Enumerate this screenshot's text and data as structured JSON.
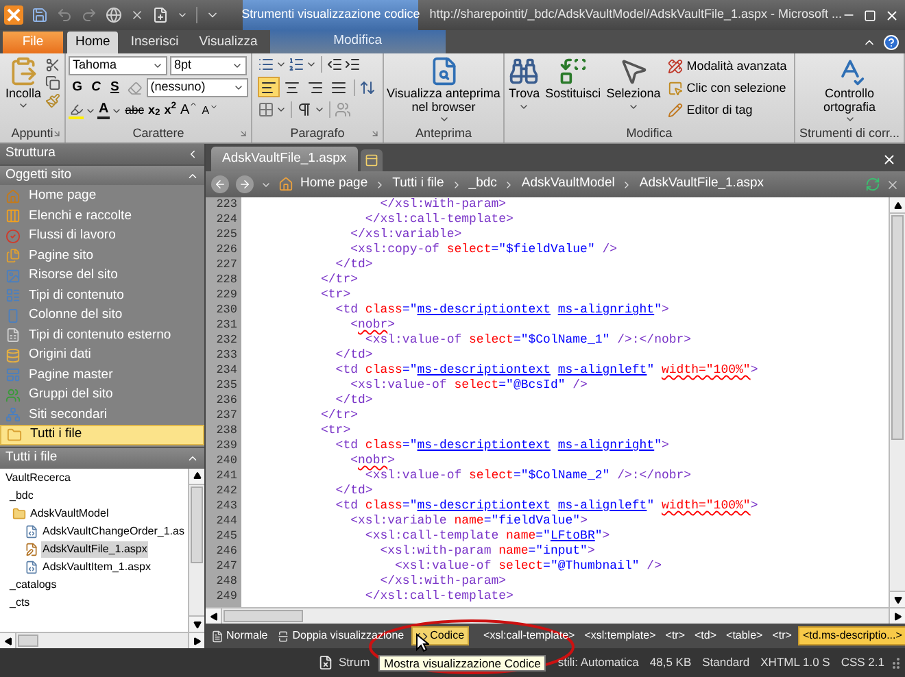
{
  "title_bar": {
    "contextual_header": "Strumenti visualizzazione codice",
    "title": "http://sharepointit/_bdc/AdskVaultModel/AdskVaultFile_1.aspx - Microsoft ..."
  },
  "ribbon_tabs": [
    {
      "label": "File",
      "kind": "file",
      "selected": false
    },
    {
      "label": "Home",
      "kind": "normal",
      "selected": true
    },
    {
      "label": "Inserisci",
      "kind": "normal",
      "selected": false
    },
    {
      "label": "Visualizza",
      "kind": "normal",
      "selected": false
    },
    {
      "label": "Modifica",
      "kind": "contextual",
      "selected": false
    }
  ],
  "ribbon": {
    "appunti": {
      "paste": "Incolla",
      "label": "Appunti"
    },
    "carattere": {
      "font": "Tahoma",
      "size": "8pt",
      "style": "(nessuno)",
      "format_buttons": [
        {
          "text": "G",
          "kind": "bold"
        },
        {
          "text": "C",
          "kind": "italic"
        },
        {
          "text": "S",
          "kind": "underline"
        }
      ],
      "font_color": "A",
      "strikethrough": "abc",
      "subscript": "x$_{2}$",
      "superscript": "x$^{2}$",
      "grow": "A",
      "shrink": "A",
      "label": "Carattere"
    },
    "paragrafo": {
      "alignment": [
        {
          "kind": "left",
          "selected": true
        },
        {
          "kind": "center",
          "selected": false
        },
        {
          "kind": "right",
          "selected": false
        },
        {
          "kind": "justify",
          "selected": false
        }
      ],
      "label": "Paragrafo"
    },
    "anteprima": {
      "button": "Visualizza anteprima nel browser",
      "label": "Anteprima"
    },
    "modifica": {
      "large_buttons": [
        {
          "label": "Trova",
          "kind": "find"
        },
        {
          "label": "Sostituisci",
          "kind": "replace"
        },
        {
          "label": "Seleziona",
          "kind": "select"
        }
      ],
      "small_buttons": [
        {
          "label": "Modalità avanzata",
          "kind": "advanced"
        },
        {
          "label": "Clic con selezione",
          "kind": "click"
        },
        {
          "label": "Editor di tag",
          "kind": "tag"
        }
      ],
      "label": "Modifica"
    },
    "strumenti": {
      "button": "Controllo ortografia",
      "label": "Strumenti di corr..."
    }
  },
  "sidebar": {
    "title": "Struttura",
    "section": "Oggetti sito",
    "items": [
      {
        "label": "Home page",
        "kind": "home",
        "selected": false
      },
      {
        "label": "Elenchi e raccolte",
        "kind": "lists",
        "selected": false
      },
      {
        "label": "Flussi di lavoro",
        "kind": "workflow",
        "selected": false
      },
      {
        "label": "Pagine sito",
        "kind": "pages",
        "selected": false
      },
      {
        "label": "Risorse del sito",
        "kind": "assets",
        "selected": false
      },
      {
        "label": "Tipi di contenuto",
        "kind": "content",
        "selected": false
      },
      {
        "label": "Colonne del sito",
        "kind": "columns",
        "selected": false
      },
      {
        "label": "Tipi di contenuto esterno",
        "kind": "external",
        "selected": false
      },
      {
        "label": "Origini dati",
        "kind": "data",
        "selected": false
      },
      {
        "label": "Pagine master",
        "kind": "master",
        "selected": false
      },
      {
        "label": "Gruppi del sito",
        "kind": "groups",
        "selected": false
      },
      {
        "label": "Siti secondari",
        "kind": "subsites",
        "selected": false
      },
      {
        "label": "Tutti i file",
        "kind": "files",
        "selected": true
      }
    ],
    "tree_title": "Tutti i file",
    "tree": [
      {
        "label": "VaultRecerca",
        "selected": false,
        "children": [
          {
            "label": "_bdc",
            "selected": false,
            "children": [
              {
                "label": "AdskVaultModel",
                "kind": "folder",
                "selected": false,
                "children": [
                  {
                    "label": "AdskVaultChangeOrder_1.as",
                    "kind": "file",
                    "selected": false
                  },
                  {
                    "label": "AdskVaultFile_1.aspx",
                    "kind": "file-edit",
                    "selected": true
                  },
                  {
                    "label": "AdskVaultItem_1.aspx",
                    "kind": "file",
                    "selected": false
                  }
                ]
              }
            ]
          },
          {
            "label": "_catalogs",
            "selected": false
          },
          {
            "label": "_cts",
            "selected": false
          }
        ]
      }
    ]
  },
  "editor": {
    "tabs": [
      {
        "label": "AdskVaultFile_1.aspx",
        "selected": true
      }
    ],
    "breadcrumb": [
      "Home page",
      "Tutti i file",
      "_bdc",
      "AdskVaultModel",
      "AdskVaultFile_1.aspx"
    ],
    "lines": [
      {
        "number": "223",
        "tokens": [
          {
            "kind": "tag",
            "text": "                  </xsl:with-param>"
          }
        ]
      },
      {
        "number": "224",
        "tokens": [
          {
            "kind": "tag",
            "text": "                </xsl:call-template>"
          }
        ]
      },
      {
        "number": "225",
        "tokens": [
          {
            "kind": "tag",
            "text": "              </xsl:variable>"
          }
        ]
      },
      {
        "number": "226",
        "tokens": [
          {
            "kind": "tag",
            "text": "              <xsl:copy-of "
          },
          {
            "kind": "attr",
            "text": "select"
          },
          {
            "kind": "str",
            "text": "=\"$fieldValue\" "
          },
          {
            "kind": "tag",
            "text": "/>"
          }
        ]
      },
      {
        "number": "227",
        "tokens": [
          {
            "kind": "tag",
            "text": "            </td>"
          }
        ]
      },
      {
        "number": "228",
        "tokens": [
          {
            "kind": "tag",
            "text": "          </tr>"
          }
        ]
      },
      {
        "number": "229",
        "tokens": [
          {
            "kind": "tag",
            "text": "          <tr>"
          }
        ]
      },
      {
        "number": "230",
        "tokens": [
          {
            "kind": "tag",
            "text": "            <td "
          },
          {
            "kind": "attr",
            "text": "class"
          },
          {
            "kind": "str",
            "text": "=\""
          },
          {
            "kind": "links",
            "items": [
              "ms-descriptiontext",
              "ms-alignright"
            ]
          },
          {
            "kind": "str",
            "text": "\""
          },
          {
            "kind": "tag",
            "text": ">"
          }
        ]
      },
      {
        "number": "231",
        "tokens": [
          {
            "kind": "tag",
            "text": "              <"
          },
          {
            "kind": "tag-error",
            "text": "nobr"
          },
          {
            "kind": "tag",
            "text": ">"
          }
        ]
      },
      {
        "number": "232",
        "tokens": [
          {
            "kind": "tag",
            "text": "                <xsl:value-of "
          },
          {
            "kind": "attr",
            "text": "select"
          },
          {
            "kind": "str",
            "text": "=\"$ColName_1\" "
          },
          {
            "kind": "tag",
            "text": "/>:</nobr>"
          }
        ]
      },
      {
        "number": "233",
        "tokens": [
          {
            "kind": "tag",
            "text": "            </td>"
          }
        ]
      },
      {
        "number": "234",
        "tokens": [
          {
            "kind": "tag",
            "text": "            <td "
          },
          {
            "kind": "attr",
            "text": "class"
          },
          {
            "kind": "str",
            "text": "=\""
          },
          {
            "kind": "links",
            "items": [
              "ms-descriptiontext",
              "ms-alignleft"
            ]
          },
          {
            "kind": "str",
            "text": "\" "
          },
          {
            "kind": "attr-error",
            "text": "width=\"100%\""
          },
          {
            "kind": "tag",
            "text": ">"
          }
        ]
      },
      {
        "number": "235",
        "tokens": [
          {
            "kind": "tag",
            "text": "              <xsl:value-of "
          },
          {
            "kind": "attr",
            "text": "select"
          },
          {
            "kind": "str",
            "text": "=\"@BcsId\" "
          },
          {
            "kind": "tag",
            "text": "/>"
          }
        ]
      },
      {
        "number": "236",
        "tokens": [
          {
            "kind": "tag",
            "text": "            </td>"
          }
        ]
      },
      {
        "number": "237",
        "tokens": [
          {
            "kind": "tag",
            "text": "          </tr>"
          }
        ]
      },
      {
        "number": "238",
        "tokens": [
          {
            "kind": "tag",
            "text": "          <tr>"
          }
        ]
      },
      {
        "number": "239",
        "tokens": [
          {
            "kind": "tag",
            "text": "            <td "
          },
          {
            "kind": "attr",
            "text": "class"
          },
          {
            "kind": "str",
            "text": "=\""
          },
          {
            "kind": "links",
            "items": [
              "ms-descriptiontext",
              "ms-alignright"
            ]
          },
          {
            "kind": "str",
            "text": "\""
          },
          {
            "kind": "tag",
            "text": ">"
          }
        ]
      },
      {
        "number": "240",
        "tokens": [
          {
            "kind": "tag",
            "text": "              <"
          },
          {
            "kind": "tag-error",
            "text": "nobr"
          },
          {
            "kind": "tag",
            "text": ">"
          }
        ]
      },
      {
        "number": "241",
        "tokens": [
          {
            "kind": "tag",
            "text": "                <xsl:value-of "
          },
          {
            "kind": "attr",
            "text": "select"
          },
          {
            "kind": "str",
            "text": "=\"$ColName_2\" "
          },
          {
            "kind": "tag",
            "text": "/>:</nobr>"
          }
        ]
      },
      {
        "number": "242",
        "tokens": [
          {
            "kind": "tag",
            "text": "            </td>"
          }
        ]
      },
      {
        "number": "243",
        "tokens": [
          {
            "kind": "tag",
            "text": "            <td "
          },
          {
            "kind": "attr",
            "text": "class"
          },
          {
            "kind": "str",
            "text": "=\""
          },
          {
            "kind": "links",
            "items": [
              "ms-descriptiontext",
              "ms-alignleft"
            ]
          },
          {
            "kind": "str",
            "text": "\" "
          },
          {
            "kind": "attr-error",
            "text": "width=\"100%\""
          },
          {
            "kind": "tag",
            "text": ">"
          }
        ]
      },
      {
        "number": "244",
        "tokens": [
          {
            "kind": "tag",
            "text": "              <xsl:variable "
          },
          {
            "kind": "attr",
            "text": "name"
          },
          {
            "kind": "str",
            "text": "=\"fieldValue\""
          },
          {
            "kind": "tag",
            "text": ">"
          }
        ]
      },
      {
        "number": "245",
        "tokens": [
          {
            "kind": "tag",
            "text": "                <xsl:call-template "
          },
          {
            "kind": "attr",
            "text": "name"
          },
          {
            "kind": "str",
            "text": "=\""
          },
          {
            "kind": "link",
            "text": "LFtoBR"
          },
          {
            "kind": "str",
            "text": "\""
          },
          {
            "kind": "tag",
            "text": ">"
          }
        ]
      },
      {
        "number": "246",
        "tokens": [
          {
            "kind": "tag",
            "text": "                  <xsl:with-param "
          },
          {
            "kind": "attr",
            "text": "name"
          },
          {
            "kind": "str",
            "text": "=\"input\""
          },
          {
            "kind": "tag",
            "text": ">"
          }
        ]
      },
      {
        "number": "247",
        "tokens": [
          {
            "kind": "tag",
            "text": "                    <xsl:value-of "
          },
          {
            "kind": "attr",
            "text": "select"
          },
          {
            "kind": "str",
            "text": "=\"@Thumbnail\" "
          },
          {
            "kind": "tag",
            "text": "/>"
          }
        ]
      },
      {
        "number": "248",
        "tokens": [
          {
            "kind": "tag",
            "text": "                  </xsl:with-param>"
          }
        ]
      },
      {
        "number": "249",
        "tokens": [
          {
            "kind": "tag",
            "text": "                </xsl:call-template>"
          }
        ]
      }
    ],
    "views": [
      {
        "label": "Normale",
        "kind": "design",
        "selected": false
      },
      {
        "label": "Doppia visualizzazione",
        "kind": "split",
        "selected": false
      },
      {
        "label": "Codice",
        "kind": "code",
        "selected": true
      }
    ],
    "tag_path": [
      {
        "label": "<xsl:call-template>",
        "selected": false
      },
      {
        "label": "<xsl:template>",
        "selected": false
      },
      {
        "label": "<tr>",
        "selected": false
      },
      {
        "label": "<td>",
        "selected": false
      },
      {
        "label": "<table>",
        "selected": false
      },
      {
        "label": "<tr>",
        "selected": false
      },
      {
        "label": "<td.ms-descriptio...>",
        "selected": true
      }
    ]
  },
  "status_bar": {
    "task": "Strum",
    "items": [
      "stili: Automatica",
      "48,5 KB",
      "Standard",
      "XHTML 1.0 S",
      "CSS 2.1"
    ]
  },
  "tooltip": {
    "text": "Mostra visualizzazione Codice"
  }
}
